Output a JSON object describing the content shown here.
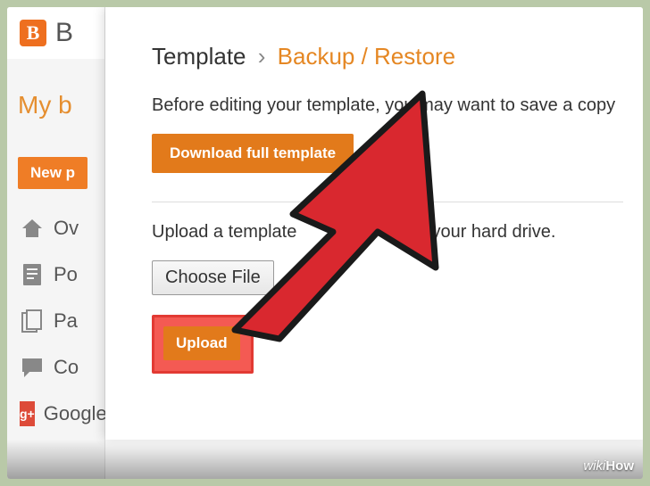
{
  "logo": {
    "letter": "B",
    "title_cut": "B"
  },
  "sidebar": {
    "heading_cut": "My b",
    "new_btn_cut": "New p",
    "items": [
      {
        "label_cut": "Ov",
        "icon": "home-icon"
      },
      {
        "label_cut": "Po",
        "icon": "posts-icon"
      },
      {
        "label_cut": "Pa",
        "icon": "pages-icon"
      },
      {
        "label_cut": "Co",
        "icon": "comments-icon"
      },
      {
        "label_cut": "Google+",
        "icon": "gplus-icon"
      }
    ]
  },
  "modal": {
    "crumb_a": "Template",
    "crumb_sep": "›",
    "crumb_b": "Backup / Restore",
    "text1": "Before editing your template, you may want to save a copy",
    "download_btn": "Download full template",
    "text2_a": "Upload a template",
    "text2_b": "your hard drive.",
    "choose_file": "Choose File",
    "upload": "Upload"
  },
  "watermark": {
    "a": "wiki",
    "b": "How"
  }
}
